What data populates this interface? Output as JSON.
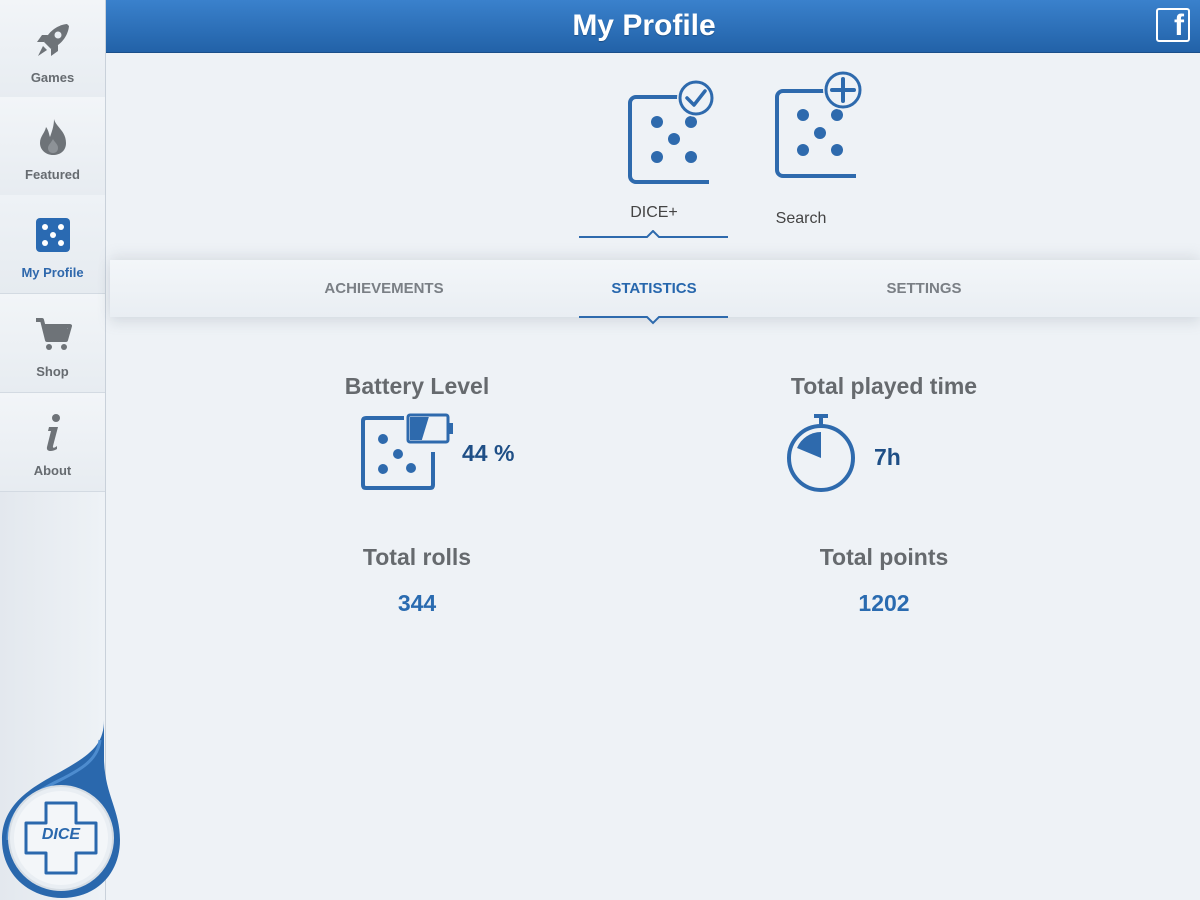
{
  "header": {
    "title": "My Profile",
    "facebook_icon": "facebook-icon"
  },
  "sidebar": {
    "items": [
      {
        "label": "Games",
        "icon": "rocket-icon"
      },
      {
        "label": "Featured",
        "icon": "flame-icon"
      },
      {
        "label": "My Profile",
        "icon": "dice-icon",
        "active": true
      },
      {
        "label": "Shop",
        "icon": "cart-icon"
      },
      {
        "label": "About",
        "icon": "info-icon"
      }
    ],
    "logo_text": "DICE"
  },
  "devices": [
    {
      "label": "DICE+",
      "icon": "dice-connected-icon",
      "selected": true
    },
    {
      "label": "Search",
      "icon": "dice-add-icon"
    }
  ],
  "tabs": [
    {
      "label": "ACHIEVEMENTS"
    },
    {
      "label": "STATISTICS",
      "active": true
    },
    {
      "label": "SETTINGS"
    }
  ],
  "stats": {
    "battery": {
      "title": "Battery Level",
      "value": "44 %",
      "level": 0.44
    },
    "played_time": {
      "title": "Total played time",
      "value": "7h"
    },
    "rolls": {
      "title": "Total rolls",
      "value": "344"
    },
    "points": {
      "title": "Total points",
      "value": "1202"
    }
  },
  "colors": {
    "accent": "#2767ad",
    "header": "#2a6ab2",
    "text_gray": "#666a6e"
  }
}
